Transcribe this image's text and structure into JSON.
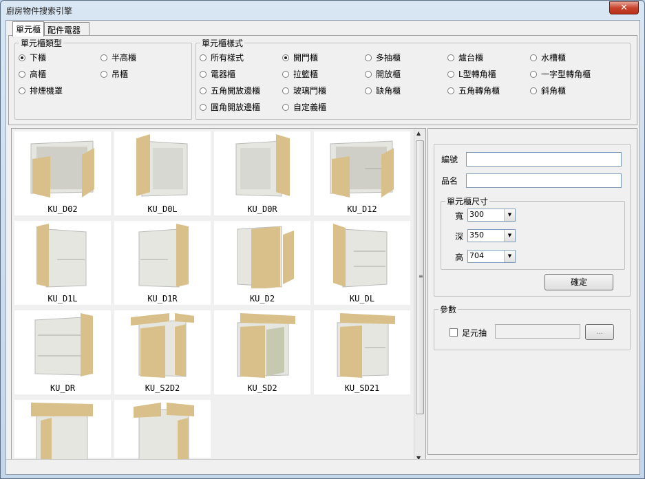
{
  "window": {
    "title": "廚房物件搜索引擎",
    "close_glyph": "✕"
  },
  "tabs": [
    {
      "label": "單元櫃"
    },
    {
      "label": "配件電器"
    }
  ],
  "type_group": {
    "legend": "單元櫃類型",
    "options": [
      {
        "label": "下櫃",
        "selected": true
      },
      {
        "label": "半高櫃",
        "selected": false
      },
      {
        "label": "高櫃",
        "selected": false
      },
      {
        "label": "吊櫃",
        "selected": false
      },
      {
        "label": "排煙機罩",
        "selected": false
      }
    ]
  },
  "style_group": {
    "legend": "單元櫃樣式",
    "options": [
      {
        "label": "所有樣式",
        "selected": false
      },
      {
        "label": "開門櫃",
        "selected": true
      },
      {
        "label": "多抽櫃",
        "selected": false
      },
      {
        "label": "爐台櫃",
        "selected": false
      },
      {
        "label": "水槽櫃",
        "selected": false
      },
      {
        "label": "電器櫃",
        "selected": false
      },
      {
        "label": "拉籃櫃",
        "selected": false
      },
      {
        "label": "開放櫃",
        "selected": false
      },
      {
        "label": "L型轉角櫃",
        "selected": false
      },
      {
        "label": "一字型轉角櫃",
        "selected": false
      },
      {
        "label": "五角開放邊櫃",
        "selected": false
      },
      {
        "label": "玻璃門櫃",
        "selected": false
      },
      {
        "label": "缺角櫃",
        "selected": false
      },
      {
        "label": "五角轉角櫃",
        "selected": false
      },
      {
        "label": "斜角櫃",
        "selected": false
      },
      {
        "label": "圓角開放邊櫃",
        "selected": false
      },
      {
        "label": "自定義櫃",
        "selected": false
      }
    ]
  },
  "gallery": {
    "items": [
      {
        "label": "KU_D02"
      },
      {
        "label": "KU_D0L"
      },
      {
        "label": "KU_D0R"
      },
      {
        "label": "KU_D12"
      },
      {
        "label": "KU_D1L"
      },
      {
        "label": "KU_D1R"
      },
      {
        "label": "KU_D2"
      },
      {
        "label": "KU_DL"
      },
      {
        "label": "KU_DR"
      },
      {
        "label": "KU_S2D2"
      },
      {
        "label": "KU_SD2"
      },
      {
        "label": "KU_SD21"
      },
      {
        "label": ""
      },
      {
        "label": ""
      }
    ]
  },
  "form": {
    "code_label": "編號",
    "name_label": "品名",
    "code_value": "",
    "name_value": "",
    "size_legend": "單元櫃尺寸",
    "width_label": "寬",
    "width_value": "300",
    "depth_label": "深",
    "depth_value": "350",
    "height_label": "高",
    "height_value": "704",
    "confirm_label": "確定"
  },
  "params": {
    "legend": "參數",
    "foot_drawer_label": "足元抽",
    "foot_drawer_checked": false,
    "foot_drawer_value": "",
    "browse_label": "..."
  },
  "colors": {
    "wood": "#d9c08a",
    "body": "#e6e6e0",
    "accent_close": "#c7432c"
  }
}
